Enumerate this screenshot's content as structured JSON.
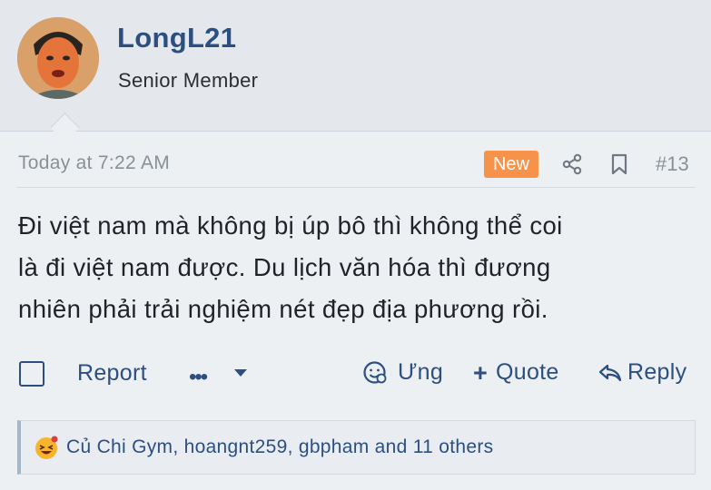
{
  "user": {
    "name": "LongL21",
    "title": "Senior Member",
    "avatar_icon": "avatar-portrait"
  },
  "post": {
    "time": "Today at 7:22 AM",
    "badge": "New",
    "number": "#13",
    "body_lines": [
      "Đi việt nam mà không bị úp bô thì không thể coi",
      "là đi việt nam được. Du lịch văn hóa thì đương",
      "nhiên phải trải nghiệm nét đẹp địa phương rồi."
    ]
  },
  "actions": {
    "report": "Report",
    "more": "•••",
    "react": "Ưng",
    "quote": "Quote",
    "reply": "Reply"
  },
  "reactions": {
    "text": "Củ Chi Gym, hoangnt259, gbpham and 11 others",
    "emoji_icon": "laughing-emoji-icon"
  },
  "colors": {
    "accent": "#2c4f82",
    "badge": "#f7924a",
    "muted": "#8a9097"
  }
}
